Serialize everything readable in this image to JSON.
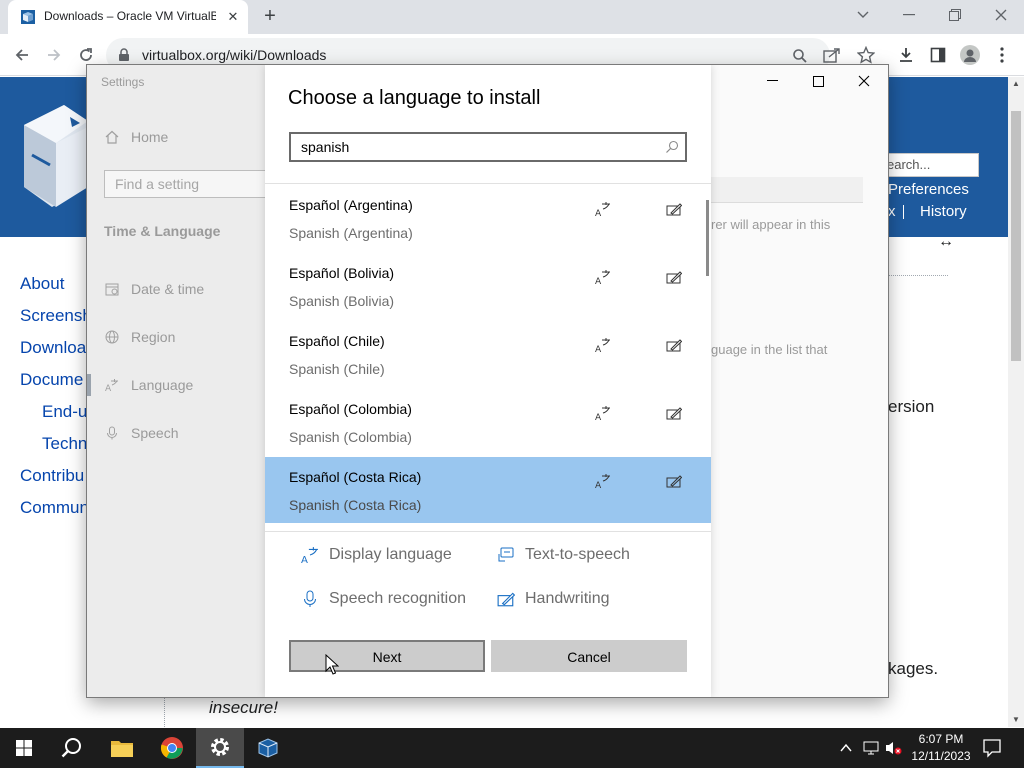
{
  "browser": {
    "tab_title": "Downloads – Oracle VM VirtualBox",
    "tab_close": "✕",
    "new_tab": "+",
    "url": "virtualbox.org/wiki/Downloads"
  },
  "webpage": {
    "nav": [
      "About",
      "Screensh",
      "Downloa",
      "Docume",
      "End-u",
      "Techn",
      "Contribu",
      "Commun"
    ],
    "search_placeholder": "earch...",
    "preferences_link": "Preferences",
    "history_link": "History",
    "history_prefix": "x",
    "arrow_glyph": "↔",
    "fragment_1": "rer will appear in this",
    "fragment_2": "guage in the list that",
    "fragment_3": "ersion",
    "fragment_4": "kages.",
    "insecure_text": "insecure!"
  },
  "settings": {
    "window_title": "Settings",
    "nav_home": "Home",
    "find_placeholder": "Find a setting",
    "section": "Time & Language",
    "nav_items": [
      {
        "label": "Date & time",
        "icon": "calendar-icon"
      },
      {
        "label": "Region",
        "icon": "globe-icon"
      },
      {
        "label": "Language",
        "icon": "language-icon"
      },
      {
        "label": "Speech",
        "icon": "microphone-icon"
      }
    ]
  },
  "dialog": {
    "title": "Choose a language to install",
    "search_value": "spanish",
    "languages": [
      {
        "name": "Español (Argentina)",
        "sub": "Spanish (Argentina)",
        "selected": false
      },
      {
        "name": "Español (Bolivia)",
        "sub": "Spanish (Bolivia)",
        "selected": false
      },
      {
        "name": "Español (Chile)",
        "sub": "Spanish (Chile)",
        "selected": false
      },
      {
        "name": "Español (Colombia)",
        "sub": "Spanish (Colombia)",
        "selected": false
      },
      {
        "name": "Español (Costa Rica)",
        "sub": "Spanish (Costa Rica)",
        "selected": true
      }
    ],
    "legend": {
      "display_language": "Display language",
      "text_to_speech": "Text-to-speech",
      "speech_recognition": "Speech recognition",
      "handwriting": "Handwriting"
    },
    "next_label": "Next",
    "cancel_label": "Cancel"
  },
  "taskbar": {
    "time": "6:07 PM",
    "date": "12/11/2023"
  },
  "colors": {
    "selection": "#99c6ef",
    "link": "#0645ad",
    "taskbar": "#1c1c1c"
  }
}
